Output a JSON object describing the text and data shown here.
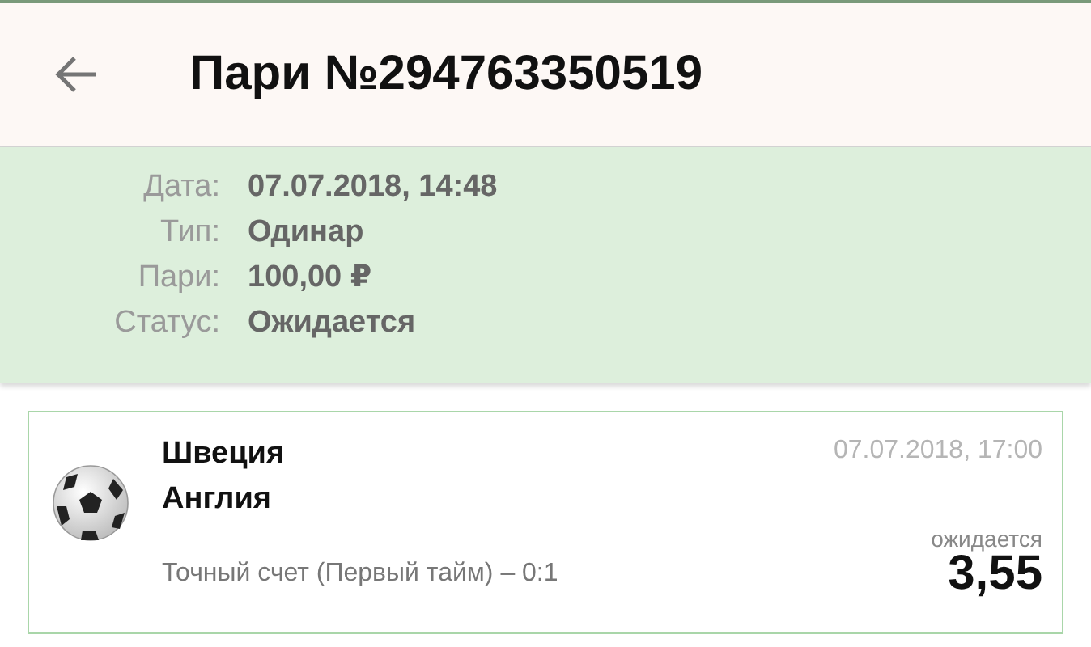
{
  "header": {
    "title": "Пари №294763350519"
  },
  "details": [
    {
      "label": "Дата:",
      "value": "07.07.2018, 14:48"
    },
    {
      "label": "Тип:",
      "value": "Одинар"
    },
    {
      "label": "Пари:",
      "value": "100,00 ₽"
    },
    {
      "label": "Статус:",
      "value": "Ожидается"
    }
  ],
  "event": {
    "team_1": "Швеция",
    "team_2": "Англия",
    "datetime": "07.07.2018, 17:00",
    "market": "Точный счет (Первый тайм) – 0:1",
    "status": "ожидается",
    "odds": "3,55"
  }
}
